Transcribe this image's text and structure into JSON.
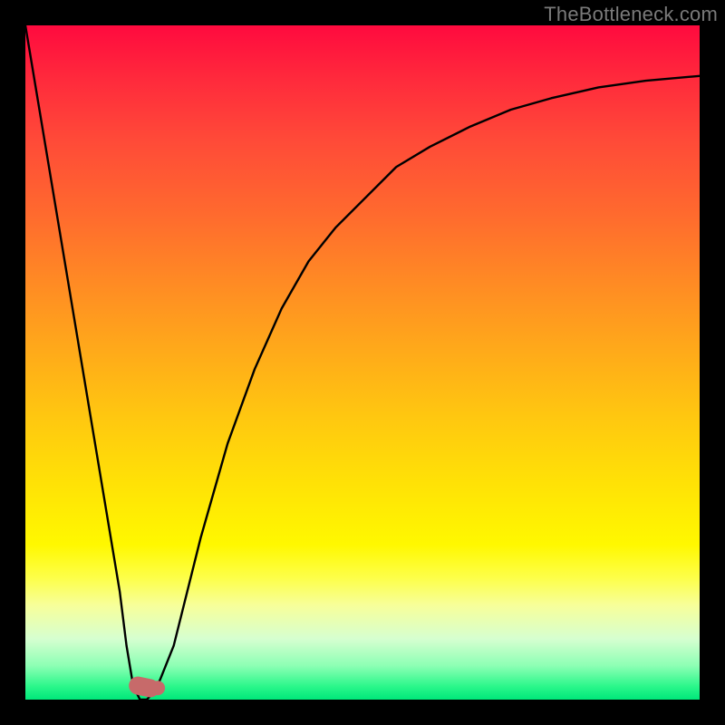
{
  "watermark": "TheBottleneck.com",
  "chart_data": {
    "type": "line",
    "title": "",
    "xlabel": "",
    "ylabel": "",
    "xlim": [
      0,
      100
    ],
    "ylim": [
      0,
      100
    ],
    "legend": false,
    "grid": false,
    "series": [
      {
        "name": "bottleneck-curve",
        "x": [
          0,
          2,
          4,
          6,
          8,
          10,
          12,
          14,
          15,
          16,
          17,
          18,
          19,
          20,
          22,
          24,
          26,
          28,
          30,
          34,
          38,
          42,
          46,
          50,
          55,
          60,
          66,
          72,
          78,
          85,
          92,
          100
        ],
        "y": [
          100,
          88,
          76,
          64,
          52,
          40,
          28,
          16,
          8,
          2,
          0,
          0,
          1,
          3,
          8,
          16,
          24,
          31,
          38,
          49,
          58,
          65,
          70,
          74,
          79,
          82,
          85,
          87.5,
          89.2,
          90.8,
          91.8,
          92.5
        ]
      }
    ],
    "marker": {
      "x": 17.5,
      "y": 0,
      "color": "#c76a6a"
    },
    "background_gradient": {
      "top": "#ff0a3e",
      "mid": "#fff200",
      "bottom": "#00e87a"
    }
  }
}
